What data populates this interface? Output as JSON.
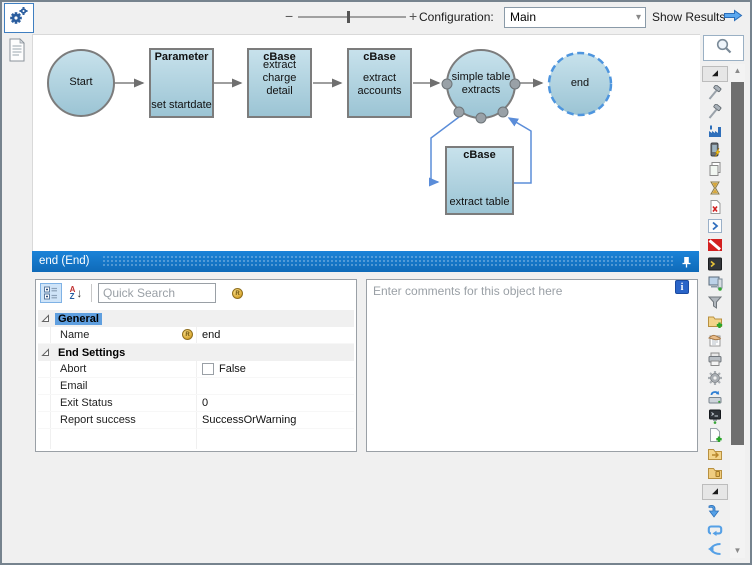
{
  "topbar": {
    "zoom_minus": "−",
    "zoom_plus": "+",
    "configuration_label": "Configuration:",
    "configuration_value": "Main",
    "show_results_label": "Show Results"
  },
  "left_strip": {
    "icons": [
      "process-gears",
      "document"
    ]
  },
  "flow": {
    "nodes": {
      "start": {
        "label": "Start"
      },
      "parameter": {
        "title": "Parameter",
        "subtitle": "set startdate"
      },
      "cbase_charge": {
        "title": "cBase",
        "body": "extract charge detail"
      },
      "cbase_accounts": {
        "title": "cBase",
        "body": "extract accounts"
      },
      "simple_table": {
        "label": "simple table extracts"
      },
      "end": {
        "label": "end"
      },
      "cbase_table": {
        "title": "cBase",
        "subtitle": "extract table"
      }
    }
  },
  "panel": {
    "title": "end (End)",
    "quick_search_placeholder": "Quick Search",
    "properties": [
      {
        "type": "category",
        "label": "General",
        "selected": true
      },
      {
        "type": "row",
        "label": "Name",
        "value": "end",
        "value_icon": "coin"
      },
      {
        "type": "category",
        "label": "End Settings"
      },
      {
        "type": "row",
        "label": "Abort",
        "value": "False",
        "checkbox": true
      },
      {
        "type": "row",
        "label": "Email",
        "value": ""
      },
      {
        "type": "row",
        "label": "Exit Status",
        "value": "0"
      },
      {
        "type": "row",
        "label": "Report success",
        "value": "SuccessOrWarning"
      }
    ],
    "comments_placeholder": "Enter comments for this object here"
  },
  "right_toolbar": {
    "icons": [
      "magnifier",
      "pointer",
      "hammer",
      "hammer-2",
      "factory",
      "mobile-flash",
      "copy-pages",
      "hourglass",
      "document-delete",
      "chevron-right-box",
      "no-entry",
      "console",
      "computer-network",
      "filter-funnel",
      "folder-add",
      "contract-sign",
      "printer",
      "gear",
      "drive-sync",
      "terminal-monitor",
      "document-add",
      "folder-export",
      "folder-closed",
      "pointer-2",
      "arrow-down-join",
      "loop-repeat",
      "branch-split"
    ]
  },
  "colors": {
    "node_fill": "#aed2e0",
    "node_border": "#7c7c7c",
    "connector_blue": "#5b8dd9",
    "titlebar_blue": "#1274c4",
    "accent_blue": "#2a64c8"
  }
}
